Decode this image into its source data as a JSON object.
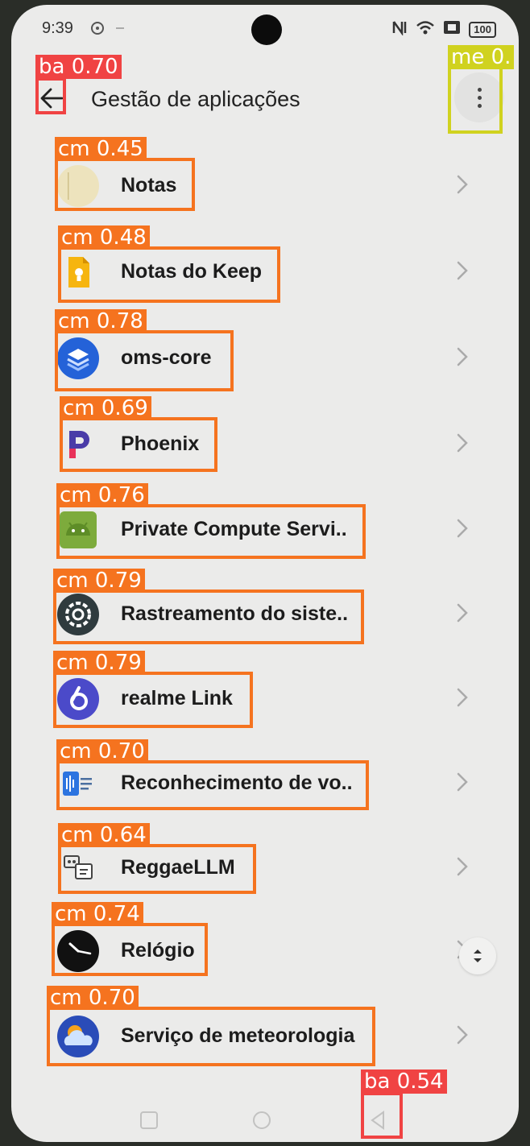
{
  "status_bar": {
    "time": "9:39",
    "battery": "100"
  },
  "header": {
    "title": "Gestão de aplicações"
  },
  "apps": [
    {
      "name": "Notas",
      "icon": "notes-icon"
    },
    {
      "name": "Notas do Keep",
      "icon": "keep-notes-icon"
    },
    {
      "name": "oms-core",
      "icon": "oms-core-icon"
    },
    {
      "name": "Phoenix",
      "icon": "phoenix-icon"
    },
    {
      "name": "Private Compute Servi..",
      "icon": "android-icon"
    },
    {
      "name": "Rastreamento do siste..",
      "icon": "gear-icon"
    },
    {
      "name": "realme Link",
      "icon": "realme-link-icon"
    },
    {
      "name": "Reconhecimento de vo..",
      "icon": "voice-recognition-icon"
    },
    {
      "name": "ReggaeLLM",
      "icon": "reggaellm-icon"
    },
    {
      "name": "Relógio",
      "icon": "clock-icon"
    },
    {
      "name": "Serviço de meteorologia",
      "icon": "weather-icon"
    }
  ],
  "detections": [
    {
      "label": "ba 0.70"
    },
    {
      "label": "me 0."
    },
    {
      "label": "cm 0.45"
    },
    {
      "label": "cm 0.48"
    },
    {
      "label": "cm 0.78"
    },
    {
      "label": "cm 0.69"
    },
    {
      "label": "cm 0.76"
    },
    {
      "label": "cm 0.79"
    },
    {
      "label": "cm 0.79"
    },
    {
      "label": "cm 0.70"
    },
    {
      "label": "cm 0.64"
    },
    {
      "label": "cm 0.74"
    },
    {
      "label": "cm 0.70"
    },
    {
      "label": "ba 0.54"
    }
  ],
  "colors": {
    "ba": "#f04343",
    "me": "#d0d21f",
    "cm": "#f5731f"
  }
}
